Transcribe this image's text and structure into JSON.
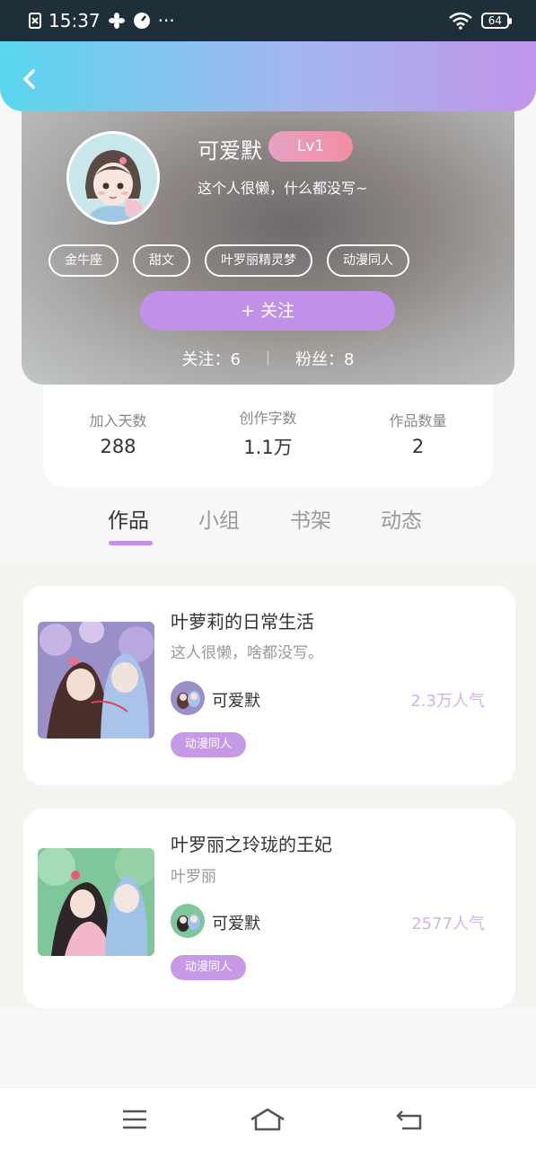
{
  "status_bar": {
    "time": "15:37",
    "battery": "64",
    "dots": "···"
  },
  "profile": {
    "username": "可爱默",
    "level": "Lv1",
    "bio": "这个人很懒，什么都没写~",
    "tags": [
      "金牛座",
      "甜文",
      "叶罗丽精灵梦",
      "动漫同人"
    ],
    "follow_button": "+  关注",
    "following": "关注：6",
    "fans": "粉丝：8"
  },
  "stats": [
    {
      "label": "加入天数",
      "value": "288"
    },
    {
      "label": "创作字数",
      "value": "1.1万"
    },
    {
      "label": "作品数量",
      "value": "2"
    }
  ],
  "tabs": [
    "作品",
    "小组",
    "书架",
    "动态"
  ],
  "works": [
    {
      "title": "叶萝莉的日常生活",
      "description": "这人很懒，啥都没写。",
      "author": "可爱默",
      "popularity": "2.3万人气",
      "tag": "动漫同人"
    },
    {
      "title": "叶罗丽之玲珑的王妃",
      "description": "叶罗丽",
      "author": "可爱默",
      "popularity": "2577人气",
      "tag": "动漫同人"
    }
  ],
  "colors": {
    "accent": "#c190e9",
    "header_start": "#5ad6ef",
    "header_end": "#c195ea",
    "popularity": "#d7b0ee"
  },
  "icons": [
    "sim-icon",
    "fan-icon",
    "speed-icon",
    "wifi-icon",
    "battery-icon",
    "back-icon",
    "menu-icon",
    "home-icon",
    "return-icon"
  ]
}
